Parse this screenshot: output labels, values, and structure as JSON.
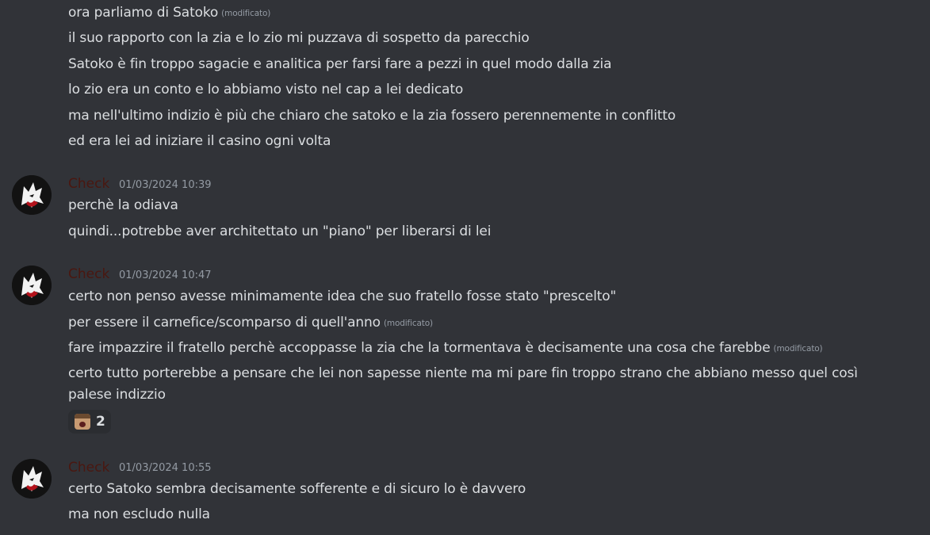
{
  "edited_label": "(modificato)",
  "intro_lines": [
    {
      "text": "ora parliamo di Satoko",
      "edited": true
    },
    {
      "text": "il suo rapporto con la zia e lo zio mi puzzava di sospetto da parecchio",
      "edited": false
    },
    {
      "text": "Satoko è fin troppo sagacie e analitica per farsi fare a pezzi in quel modo dalla zia",
      "edited": false
    },
    {
      "text": "lo zio era un conto e lo abbiamo visto nel cap a lei dedicato",
      "edited": false
    },
    {
      "text": "ma nell'ultimo indizio è più che chiaro che satoko e la zia fossero perennemente in conflitto",
      "edited": false
    },
    {
      "text": "ed era lei ad iniziare il casino ogni volta",
      "edited": false
    }
  ],
  "messages": [
    {
      "author": "Check",
      "timestamp": "01/03/2024 10:39",
      "lines": [
        {
          "text": "perchè la odiava",
          "edited": false
        },
        {
          "text": "quindi...potrebbe aver architettato un \"piano\" per liberarsi di lei",
          "edited": false
        }
      ]
    },
    {
      "author": "Check",
      "timestamp": "01/03/2024 10:47",
      "lines": [
        {
          "text": "certo non penso avesse minimamente idea che suo fratello fosse stato \"prescelto\"",
          "edited": false
        },
        {
          "text": "per essere il carnefice/scomparso di quell'anno",
          "edited": true
        },
        {
          "text": "fare impazzire il fratello perchè accoppasse la zia che la tormentava è decisamente una cosa che farebbe",
          "edited": true
        },
        {
          "text": "certo tutto porterebbe a pensare che lei non sapesse niente ma mi pare fin troppo strano che abbiano messo quel così",
          "edited": false
        },
        {
          "text": "palese indizzio",
          "edited": false
        }
      ],
      "reaction": {
        "emoji": "reaction-emoji-face",
        "count": "2"
      }
    },
    {
      "author": "Check",
      "timestamp": "01/03/2024 10:55",
      "lines": [
        {
          "text": "certo Satoko sembra decisamente sofferente e di sicuro lo è davvero",
          "edited": false
        },
        {
          "text": "ma non escludo nulla",
          "edited": false
        }
      ]
    }
  ],
  "colors": {
    "background": "#313338",
    "text": "#dbdee1",
    "muted": "#949ba4",
    "author": "#4a1710"
  }
}
